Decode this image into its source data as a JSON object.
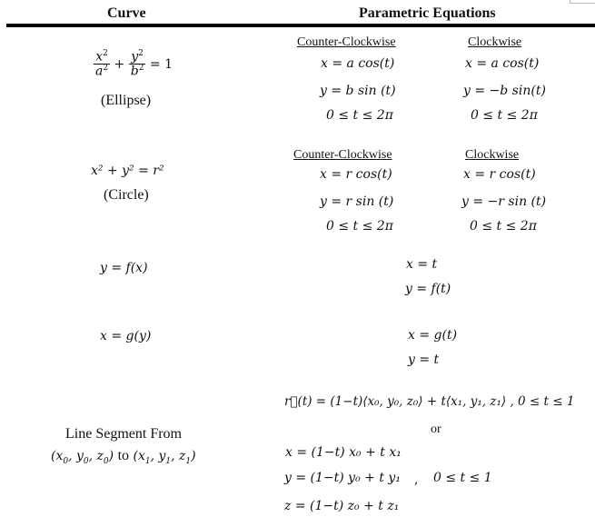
{
  "header": {
    "curve": "Curve",
    "parametric": "Parametric Equations"
  },
  "rows": {
    "ellipse": {
      "name": "(Ellipse)",
      "equation_plus": "+",
      "equation_rhs": "= 1",
      "ccw_label": "Counter-Clockwise",
      "cw_label": "Clockwise",
      "ccw": [
        "x = a cos(t)",
        "y = b sin (t)",
        "0 ≤ t ≤ 2π"
      ],
      "cw": [
        "x = a cos(t)",
        "y = −b sin(t)",
        "0 ≤ t ≤ 2π"
      ]
    },
    "circle": {
      "name": "(Circle)",
      "equation": "x² + y² = r²",
      "ccw_label": "Counter-Clockwise",
      "cw_label": "Clockwise",
      "ccw": [
        "x = r cos(t)",
        "y = r sin (t)",
        "0 ≤ t ≤ 2π"
      ],
      "cw": [
        "x = r cos(t)",
        "y = −r sin (t)",
        "0 ≤ t ≤ 2π"
      ]
    },
    "function_y": {
      "equation": "y = f(x)",
      "param": [
        "x = t",
        "y = f(t)"
      ]
    },
    "function_x": {
      "equation": "x = g(y)",
      "param": [
        "x = g(t)",
        "y = t"
      ]
    },
    "line_segment": {
      "name": "Line Segment From",
      "endpoints_to": "to",
      "vector_form": "r⃗(t) = (1−t)⟨x₀, y₀, z₀⟩ + t⟨x₁, y₁, z₁⟩ , 0 ≤ t ≤ 1",
      "or": "or",
      "components": [
        "x = (1−t) x₀ + t x₁",
        "y = (1−t) y₀ + t y₁",
        "z = (1−t) z₀ + t z₁"
      ],
      "range": "0 ≤ t ≤ 1",
      "comma": ","
    }
  }
}
